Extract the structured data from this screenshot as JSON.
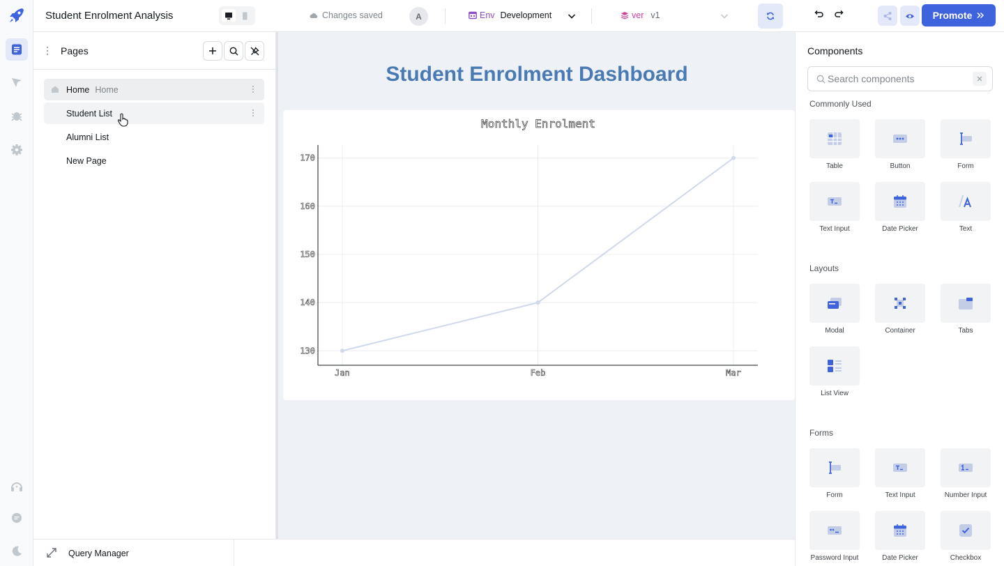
{
  "header": {
    "app_title": "Student Enrolment Analysis",
    "save_status": "Changes saved",
    "avatar_initial": "A",
    "env_label": "Env",
    "env_value": "Development",
    "version_label": "ver",
    "version_value": "v1",
    "promote_label": "Promote"
  },
  "pages_panel": {
    "title": "Pages",
    "pages": [
      {
        "label": "Home",
        "sublabel": "Home"
      },
      {
        "label": "Student List"
      },
      {
        "label": "Alumni List"
      },
      {
        "label": "New Page"
      }
    ]
  },
  "canvas": {
    "dashboard_title": "Student Enrolment Dashboard"
  },
  "chart_data": {
    "type": "line",
    "title": "Monthly Enrolment",
    "categories": [
      "Jan",
      "Feb",
      "Mar"
    ],
    "series": [
      {
        "values": [
          130,
          140,
          170
        ],
        "color": "#d0d8eb"
      }
    ],
    "yticks": [
      130,
      140,
      150,
      160,
      170
    ],
    "ylim": [
      127,
      172.7
    ],
    "grid": true
  },
  "bottom_bar": {
    "query_manager_label": "Query Manager"
  },
  "components_panel": {
    "title": "Components",
    "search_placeholder": "Search components",
    "sections": [
      {
        "title": "Commonly Used",
        "items": [
          "Table",
          "Button",
          "Form",
          "Text Input",
          "Date Picker",
          "Text"
        ]
      },
      {
        "title": "Layouts",
        "items": [
          "Modal",
          "Container",
          "Tabs",
          "List View"
        ]
      },
      {
        "title": "Forms",
        "items": [
          "Form",
          "Text Input",
          "Number Input",
          "Password Input",
          "Date Picker",
          "Checkbox"
        ]
      }
    ]
  },
  "colors": {
    "accent": "#3e63dd",
    "accent_soft": "#e3e9f9",
    "dashboard_title": "#4a7ab3",
    "env": "#8e4ec6",
    "version": "#d6409f"
  }
}
